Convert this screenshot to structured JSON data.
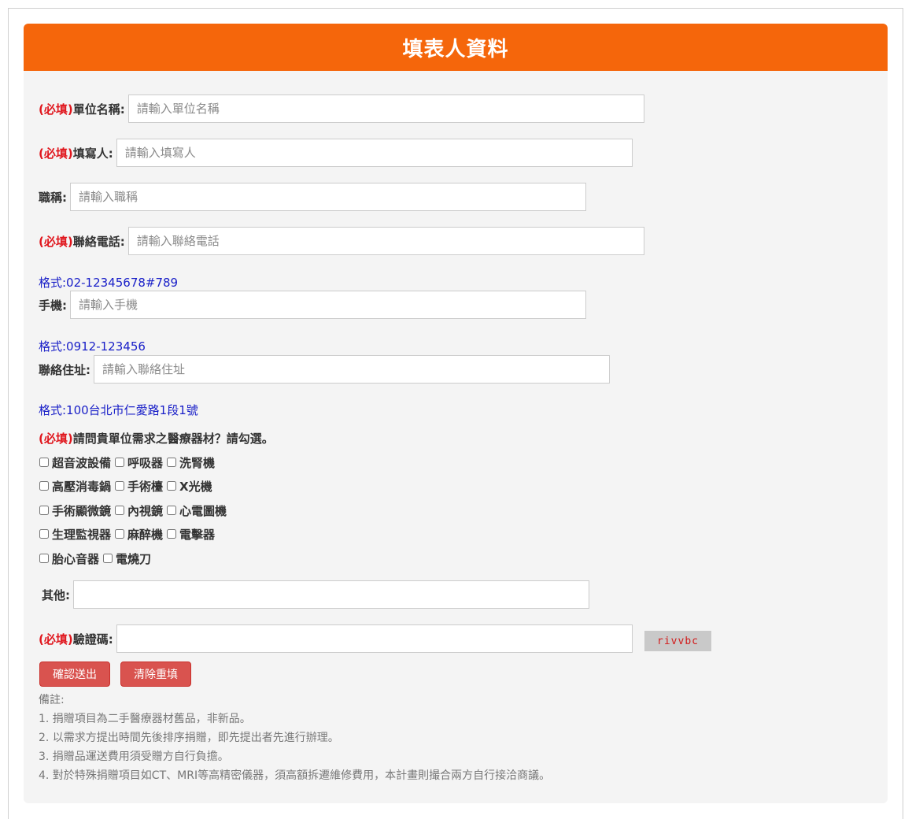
{
  "header": {
    "title": "填表人資料"
  },
  "required_tag": "(必填)",
  "fields": {
    "unit_name": {
      "label": "單位名稱:",
      "placeholder": "請輸入單位名稱"
    },
    "filler": {
      "label": "填寫人:",
      "placeholder": "請輸入填寫人"
    },
    "job_title": {
      "label": "職稱:",
      "placeholder": "請輸入職稱"
    },
    "phone": {
      "label": "聯絡電話:",
      "placeholder": "請輸入聯絡電話",
      "hint": "格式:02-12345678#789"
    },
    "mobile": {
      "label": "手機:",
      "placeholder": "請輸入手機",
      "hint": "格式:0912-123456"
    },
    "address": {
      "label": "聯絡住址:",
      "placeholder": "請輸入聯絡住址",
      "hint": "格式:100台北市仁愛路1段1號"
    },
    "other": {
      "label": "其他:",
      "value": ""
    },
    "captcha": {
      "label": "驗證碼:",
      "value": "",
      "image_text": "rivvbc"
    }
  },
  "equipment": {
    "question": "請問貴單位需求之醫療器材？請勾選。",
    "rows": [
      [
        "超音波設備",
        "呼吸器",
        "洗腎機"
      ],
      [
        "高壓消毒鍋",
        "手術檯",
        "X光機"
      ],
      [
        "手術顯微鏡",
        "內視鏡",
        "心電圖機"
      ],
      [
        "生理監視器",
        "麻醉機",
        "電擊器"
      ],
      [
        "胎心音器",
        "電燒刀"
      ]
    ]
  },
  "buttons": {
    "submit": "確認送出",
    "reset": "清除重填"
  },
  "notes": {
    "title": "備註:",
    "items": [
      "1. 捐贈項目為二手醫療器材舊品，非新品。",
      "2. 以需求方提出時間先後排序捐贈，即先提出者先進行辦理。",
      "3. 捐贈品運送費用須受贈方自行負擔。",
      "4. 對於特殊捐贈項目如CT、MRI等高精密儀器，須高額拆遷維修費用，本計畫則撮合兩方自行接洽商議。"
    ]
  },
  "colors": {
    "header": "#f5660b",
    "required": "#e0161d",
    "hint": "#1a20c8",
    "button": "#d9534f"
  }
}
